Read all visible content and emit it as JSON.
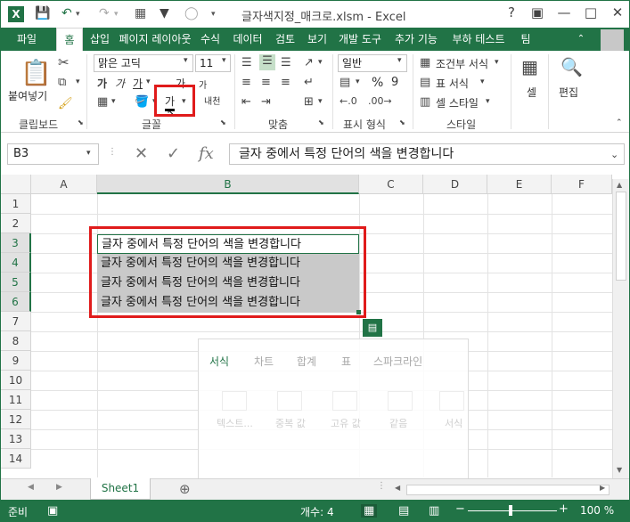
{
  "title_bar": {
    "app_icon": "X",
    "title": "글자색지정_매크로.xlsm - Excel",
    "qat_icons": [
      "save-icon",
      "undo-icon",
      "redo-icon",
      "filter-icon",
      "circle-icon"
    ],
    "window_controls": [
      "?",
      "▣",
      "—",
      "□",
      "✕"
    ]
  },
  "tabs": [
    "파일",
    "홈",
    "삽입",
    "페이지 레이아웃",
    "수식",
    "데이터",
    "검토",
    "보기",
    "개발 도구",
    "추가 기능",
    "부하 테스트",
    "팀"
  ],
  "ribbon": {
    "clipboard": {
      "paste_label": "붙여넣기",
      "group_label": "클립보드"
    },
    "font": {
      "font_name": "맑은 고딕",
      "font_size": "11",
      "bold": "가",
      "italic": "가",
      "underline": "가",
      "grow": "가",
      "shrink": "가",
      "font_color_glyph": "가",
      "phonetic": "내천",
      "group_label": "글꼴"
    },
    "alignment": {
      "group_label": "맞춤"
    },
    "number": {
      "format": "일반",
      "percent": "%",
      "comma": "9",
      "group_label": "표시 형식"
    },
    "styles": {
      "conditional": "조건부 서식",
      "table": "표 서식",
      "cell_styles": "셀 스타일",
      "group_label": "스타일"
    },
    "cells": {
      "label": "셀"
    },
    "editing": {
      "label": "편집"
    }
  },
  "formula_bar": {
    "name_box": "B3",
    "fx": "fx",
    "content": "글자 중에서 특정 단어의 색을 변경합니다"
  },
  "grid": {
    "columns": [
      "A",
      "B",
      "C",
      "D",
      "E",
      "F"
    ],
    "rows": [
      "1",
      "2",
      "3",
      "4",
      "5",
      "6",
      "7",
      "8",
      "9",
      "10",
      "11",
      "12",
      "13",
      "14"
    ],
    "selected_column": "B",
    "cells": [
      {
        "ref": "B3",
        "text": "글자 중에서 특정 단어의 색을 변경합니다"
      },
      {
        "ref": "B4",
        "text": "글자 중에서 특정 단어의 색을 변경합니다"
      },
      {
        "ref": "B5",
        "text": "글자 중에서 특정 단어의 색을 변경합니다"
      },
      {
        "ref": "B6",
        "text": "글자 중에서 특정 단어의 색을 변경합니다"
      }
    ]
  },
  "quick_analysis": {
    "tabs": [
      "서식",
      "차트",
      "합계",
      "표",
      "스파크라인"
    ],
    "items": [
      "텍스트...",
      "중복 값",
      "고유 값",
      "같음",
      "서식"
    ]
  },
  "sheet_tabs": {
    "active": "Sheet1",
    "add_icon": "plus-icon"
  },
  "status_bar": {
    "mode": "준비",
    "count": "개수: 4",
    "zoom": "100 %"
  },
  "colors": {
    "excel_green": "#217346",
    "highlight_red": "#e01b1b",
    "selection_gray": "#c9c9c9"
  }
}
